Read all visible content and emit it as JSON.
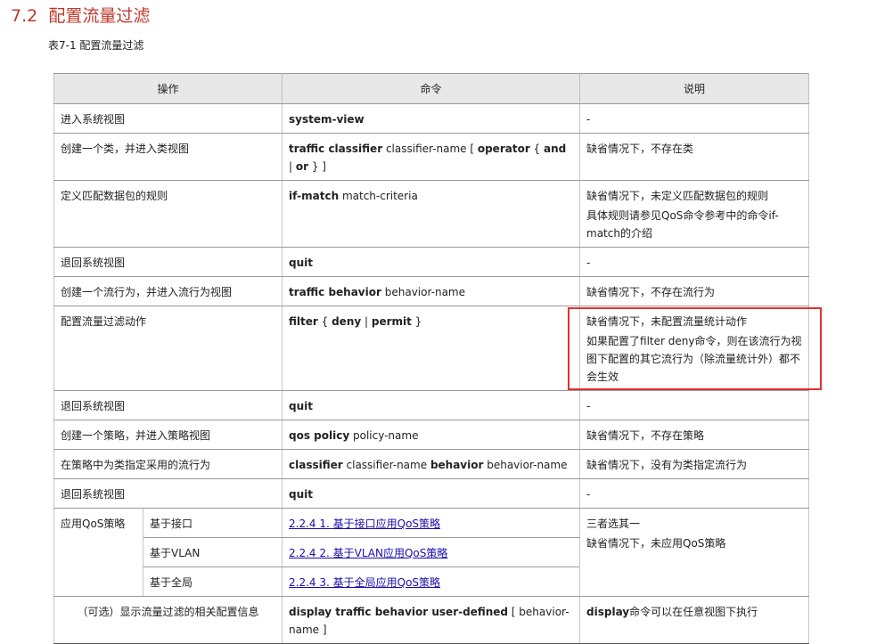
{
  "section": {
    "number": "7.2",
    "title": "配置流量过滤"
  },
  "table": {
    "caption": "表7-1 配置流量过滤",
    "headers": [
      "操作",
      "命令",
      "说明"
    ],
    "rows": [
      {
        "op": "进入系统视图",
        "cmd": [
          {
            "t": "system-view",
            "b": true
          }
        ],
        "notes": [
          "-"
        ]
      },
      {
        "op": "创建一个类，并进入类视图",
        "cmd": [
          {
            "t": "traffic classifier",
            "b": true
          },
          {
            "t": " classifier-name [ ",
            "b": false
          },
          {
            "t": "operator",
            "b": true
          },
          {
            "t": " { ",
            "b": false
          },
          {
            "t": "and",
            "b": true
          },
          {
            "t": " | ",
            "b": false
          },
          {
            "t": "or",
            "b": true
          },
          {
            "t": " } ]",
            "b": false
          }
        ],
        "notes": [
          "缺省情况下，不存在类"
        ]
      },
      {
        "op": "定义匹配数据包的规则",
        "cmd": [
          {
            "t": "if-match",
            "b": true
          },
          {
            "t": " match-criteria",
            "b": false
          }
        ],
        "notes": [
          "缺省情况下，未定义匹配数据包的规则",
          "具体规则请参见QoS命令参考中的命令if-match的介绍"
        ]
      },
      {
        "op": "退回系统视图",
        "cmd": [
          {
            "t": "quit",
            "b": true
          }
        ],
        "notes": [
          "-"
        ]
      },
      {
        "op": "创建一个流行为，并进入流行为视图",
        "cmd": [
          {
            "t": "traffic behavior",
            "b": true
          },
          {
            "t": " behavior-name",
            "b": false
          }
        ],
        "notes": [
          "缺省情况下，不存在流行为"
        ]
      },
      {
        "op": "配置流量过滤动作",
        "cmd": [
          {
            "t": "filter",
            "b": true
          },
          {
            "t": " { ",
            "b": false
          },
          {
            "t": "deny",
            "b": true
          },
          {
            "t": " | ",
            "b": false
          },
          {
            "t": "permit",
            "b": true
          },
          {
            "t": " }",
            "b": false
          }
        ],
        "notes": [
          "缺省情况下，未配置流量统计动作",
          "如果配置了filter deny命令，则在该流行为视图下配置的其它流行为（除流量统计外）都不会生效"
        ]
      },
      {
        "op": "退回系统视图",
        "cmd": [
          {
            "t": "quit",
            "b": true
          }
        ],
        "notes": [
          "-"
        ]
      },
      {
        "op": "创建一个策略，并进入策略视图",
        "cmd": [
          {
            "t": "qos policy",
            "b": true
          },
          {
            "t": " policy-name",
            "b": false
          }
        ],
        "notes": [
          "缺省情况下，不存在策略"
        ]
      },
      {
        "op": "在策略中为类指定采用的流行为",
        "cmd": [
          {
            "t": "classifier",
            "b": true
          },
          {
            "t": " classifier-name ",
            "b": false
          },
          {
            "t": "behavior",
            "b": true
          },
          {
            "t": " behavior-name",
            "b": false
          }
        ],
        "notes": [
          "缺省情况下，没有为类指定流行为"
        ]
      },
      {
        "op": "退回系统视图",
        "cmd": [
          {
            "t": "quit",
            "b": true
          }
        ],
        "notes": [
          "-"
        ]
      }
    ],
    "apply_policy": {
      "op": "应用QoS策略",
      "subs": [
        {
          "label": "基于接口",
          "link": "2.2.4  1. 基于接口应用QoS策略"
        },
        {
          "label": "基于VLAN",
          "link": "2.2.4  2. 基于VLAN应用QoS策略"
        },
        {
          "label": "基于全局",
          "link": "2.2.4  3. 基于全局应用QoS策略"
        }
      ],
      "notes": [
        "三者选其一",
        "缺省情况下，未应用QoS策略"
      ]
    },
    "display_row": {
      "op": "（可选）显示流量过滤的相关配置信息",
      "cmd": [
        {
          "t": "display traffic behavior user-defined",
          "b": true
        },
        {
          "t": " [ behavior-name ]",
          "b": false
        }
      ],
      "notes": [
        {
          "t": "display",
          "b": true
        },
        {
          "t": "命令可以在任意视图下执行",
          "b": false
        }
      ]
    }
  },
  "highlight_color": "#e0322f"
}
